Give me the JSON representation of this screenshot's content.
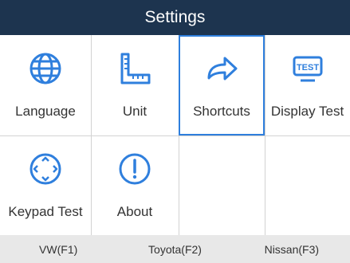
{
  "title": "Settings",
  "accent_color": "#2f7fdd",
  "titlebar_color": "#1d344f",
  "tiles": [
    {
      "label": "Language",
      "icon": "globe-icon",
      "selected": false
    },
    {
      "label": "Unit",
      "icon": "ruler-icon",
      "selected": false
    },
    {
      "label": "Shortcuts",
      "icon": "share-arrow-icon",
      "selected": true
    },
    {
      "label": "Display Test",
      "icon": "test-screen-icon",
      "selected": false
    },
    {
      "label": "Keypad Test",
      "icon": "dpad-icon",
      "selected": false
    },
    {
      "label": "About",
      "icon": "info-exclamation-icon",
      "selected": false
    }
  ],
  "function_keys": [
    {
      "label": "VW(F1)"
    },
    {
      "label": "Toyota(F2)"
    },
    {
      "label": "Nissan(F3)"
    }
  ]
}
